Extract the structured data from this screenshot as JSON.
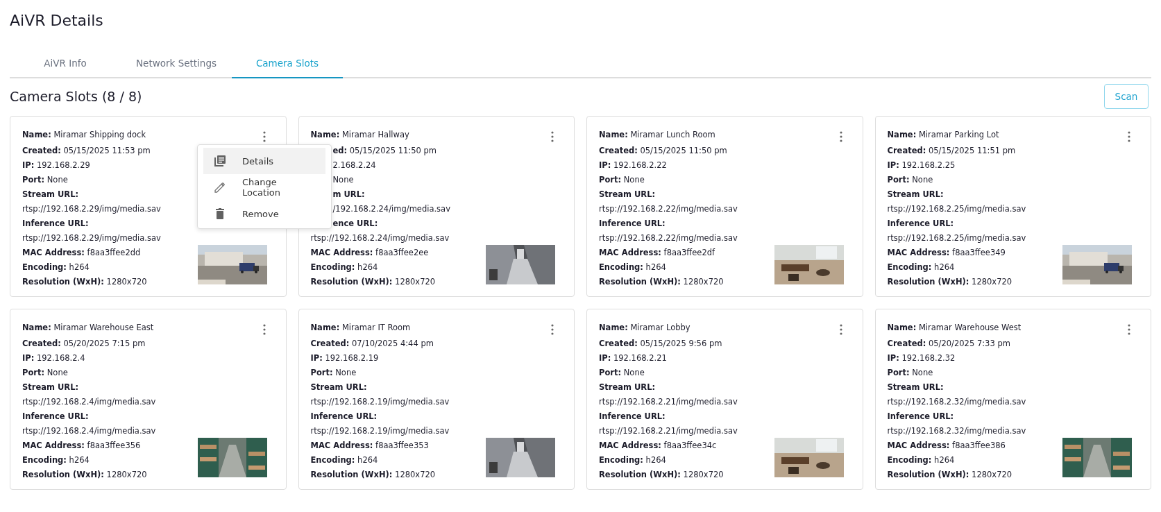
{
  "title": "AiVR Details",
  "tabs": [
    {
      "label": "AiVR Info",
      "selected": false
    },
    {
      "label": "Network Settings",
      "selected": false
    },
    {
      "label": "Camera Slots",
      "selected": true
    }
  ],
  "section": {
    "heading": "Camera Slots (8 / 8)",
    "scan_button": "Scan"
  },
  "cards": [
    {
      "lines": [
        {
          "kind": "field",
          "text": "**Name:** Miramar Shipping dock"
        },
        {
          "kind": "field",
          "text": "**Created:** 05/15/2025 11:53 pm"
        },
        {
          "kind": "field",
          "text": "**IP:** 192.168.2.29"
        },
        {
          "kind": "field",
          "text": "**Port:** None"
        },
        {
          "kind": "label",
          "text": "Stream URL:"
        },
        {
          "kind": "value",
          "text": "rtsp://192.168.2.29/img/media.sav"
        },
        {
          "kind": "label",
          "text": "Inference URL:"
        },
        {
          "kind": "value",
          "text": "rtsp://192.168.2.29/img/media.sav"
        },
        {
          "kind": "field",
          "text": "**MAC Address:** f8aa3ffee2dd"
        },
        {
          "kind": "field",
          "text": "**Encoding:** h264"
        },
        {
          "kind": "field",
          "text": "**Resolution (WxH):** 1280x720"
        }
      ],
      "menu": [
        {
          "kind": "details",
          "label": "Details",
          "selected": true
        },
        {
          "kind": "edit",
          "label": "Change Location",
          "selected": false
        },
        {
          "kind": "delete",
          "label": "Remove",
          "selected": false
        }
      ]
    },
    {
      "lines": [
        {
          "kind": "field",
          "text": "**Name:** Miramar Hallway"
        },
        {
          "kind": "field_covered",
          "text": "**ed:** 05/15/2025 11:50 pm"
        },
        {
          "kind": "value_covered",
          "text": "2.168.2.24"
        },
        {
          "kind": "value_covered",
          "text": "None"
        },
        {
          "kind": "label_covered",
          "text": "m URL:"
        },
        {
          "kind": "value_covered",
          "text": "/192.168.2.24/img/media.sav"
        },
        {
          "kind": "label_covered",
          "text": "ence URL:"
        },
        {
          "kind": "value",
          "text": "rtsp://192.168.2.24/img/media.sav"
        },
        {
          "kind": "field",
          "text": "**MAC Address:** f8aa3ffee2ee"
        },
        {
          "kind": "field",
          "text": "**Encoding:** h264"
        },
        {
          "kind": "field",
          "text": "**Resolution (WxH):** 1280x720"
        }
      ]
    },
    {
      "lines": [
        {
          "kind": "field",
          "text": "**Name:** Miramar Lunch Room"
        },
        {
          "kind": "field",
          "text": "**Created:** 05/15/2025 11:50 pm"
        },
        {
          "kind": "field",
          "text": "**IP:** 192.168.2.22"
        },
        {
          "kind": "field",
          "text": "**Port:** None"
        },
        {
          "kind": "label",
          "text": "Stream URL:"
        },
        {
          "kind": "value",
          "text": "rtsp://192.168.2.22/img/media.sav"
        },
        {
          "kind": "label",
          "text": "Inference URL:"
        },
        {
          "kind": "value",
          "text": "rtsp://192.168.2.22/img/media.sav"
        },
        {
          "kind": "field",
          "text": "**MAC Address:** f8aa3ffee2df"
        },
        {
          "kind": "field",
          "text": "**Encoding:** h264"
        },
        {
          "kind": "field",
          "text": "**Resolution (WxH):** 1280x720"
        }
      ]
    },
    {
      "lines": [
        {
          "kind": "field",
          "text": "**Name:** Miramar Parking Lot"
        },
        {
          "kind": "field",
          "text": "**Created:** 05/15/2025 11:51 pm"
        },
        {
          "kind": "field",
          "text": "**IP:** 192.168.2.25"
        },
        {
          "kind": "field",
          "text": "**Port:** None"
        },
        {
          "kind": "label",
          "text": "Stream URL:"
        },
        {
          "kind": "value",
          "text": "rtsp://192.168.2.25/img/media.sav"
        },
        {
          "kind": "label",
          "text": "Inference URL:"
        },
        {
          "kind": "value",
          "text": "rtsp://192.168.2.25/img/media.sav"
        },
        {
          "kind": "field",
          "text": "**MAC Address:** f8aa3ffee349"
        },
        {
          "kind": "field",
          "text": "**Encoding:** h264"
        },
        {
          "kind": "field",
          "text": "**Resolution (WxH):** 1280x720"
        }
      ]
    },
    {
      "lines": [
        {
          "kind": "field",
          "text": "**Name:** Miramar Warehouse East"
        },
        {
          "kind": "field",
          "text": "**Created:** 05/20/2025 7:15 pm"
        },
        {
          "kind": "field",
          "text": "**IP:** 192.168.2.4"
        },
        {
          "kind": "field",
          "text": "**Port:** None"
        },
        {
          "kind": "label",
          "text": "Stream URL:"
        },
        {
          "kind": "value",
          "text": "rtsp://192.168.2.4/img/media.sav"
        },
        {
          "kind": "label",
          "text": "Inference URL:"
        },
        {
          "kind": "value",
          "text": "rtsp://192.168.2.4/img/media.sav"
        },
        {
          "kind": "field",
          "text": "**MAC Address:** f8aa3ffee356"
        },
        {
          "kind": "field",
          "text": "**Encoding:** h264"
        },
        {
          "kind": "field",
          "text": "**Resolution (WxH):** 1280x720"
        }
      ]
    },
    {
      "lines": [
        {
          "kind": "field",
          "text": "**Name:** Miramar IT Room"
        },
        {
          "kind": "field",
          "text": "**Created:** 07/10/2025 4:44 pm"
        },
        {
          "kind": "field",
          "text": "**IP:** 192.168.2.19"
        },
        {
          "kind": "field",
          "text": "**Port:** None"
        },
        {
          "kind": "label",
          "text": "Stream URL:"
        },
        {
          "kind": "value",
          "text": "rtsp://192.168.2.19/img/media.sav"
        },
        {
          "kind": "label",
          "text": "Inference URL:"
        },
        {
          "kind": "value",
          "text": "rtsp://192.168.2.19/img/media.sav"
        },
        {
          "kind": "field",
          "text": "**MAC Address:** f8aa3ffee353"
        },
        {
          "kind": "field",
          "text": "**Encoding:** h264"
        },
        {
          "kind": "field",
          "text": "**Resolution (WxH):** 1280x720"
        }
      ]
    },
    {
      "lines": [
        {
          "kind": "field",
          "text": "**Name:** Miramar Lobby"
        },
        {
          "kind": "field",
          "text": "**Created:** 05/15/2025 9:56 pm"
        },
        {
          "kind": "field",
          "text": "**IP:** 192.168.2.21"
        },
        {
          "kind": "field",
          "text": "**Port:** None"
        },
        {
          "kind": "label",
          "text": "Stream URL:"
        },
        {
          "kind": "value",
          "text": "rtsp://192.168.2.21/img/media.sav"
        },
        {
          "kind": "label",
          "text": "Inference URL:"
        },
        {
          "kind": "value",
          "text": "rtsp://192.168.2.21/img/media.sav"
        },
        {
          "kind": "field",
          "text": "**MAC Address:** f8aa3ffee34c"
        },
        {
          "kind": "field",
          "text": "**Encoding:** h264"
        },
        {
          "kind": "field",
          "text": "**Resolution (WxH):** 1280x720"
        }
      ]
    },
    {
      "lines": [
        {
          "kind": "field",
          "text": "**Name:** Miramar Warehouse West"
        },
        {
          "kind": "field",
          "text": "**Created:** 05/20/2025 7:33 pm"
        },
        {
          "kind": "field",
          "text": "**IP:** 192.168.2.32"
        },
        {
          "kind": "field",
          "text": "**Port:** None"
        },
        {
          "kind": "label",
          "text": "Stream URL:"
        },
        {
          "kind": "value",
          "text": "rtsp://192.168.2.32/img/media.sav"
        },
        {
          "kind": "label",
          "text": "Inference URL:"
        },
        {
          "kind": "value",
          "text": "rtsp://192.168.2.32/img/media.sav"
        },
        {
          "kind": "field",
          "text": "**MAC Address:** f8aa3ffee386"
        },
        {
          "kind": "field",
          "text": "**Encoding:** h264"
        },
        {
          "kind": "field",
          "text": "**Resolution (WxH):** 1280x720"
        }
      ]
    }
  ]
}
